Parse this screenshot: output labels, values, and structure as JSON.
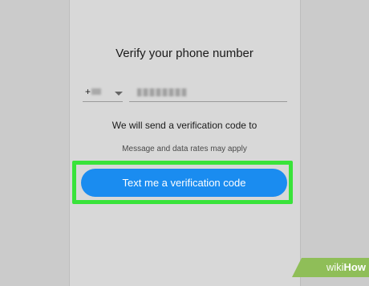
{
  "verify": {
    "title": "Verify your phone number",
    "country_code_prefix": "+",
    "send_text": "We will send a verification code to",
    "rates_text": "Message and data rates may apply",
    "button_label": "Text me a verification code"
  },
  "watermark": {
    "part1": "wiki",
    "part2": "How"
  },
  "colors": {
    "button": "#1a8cf0",
    "highlight": "#39e33a",
    "watermark": "#8fbe58"
  }
}
